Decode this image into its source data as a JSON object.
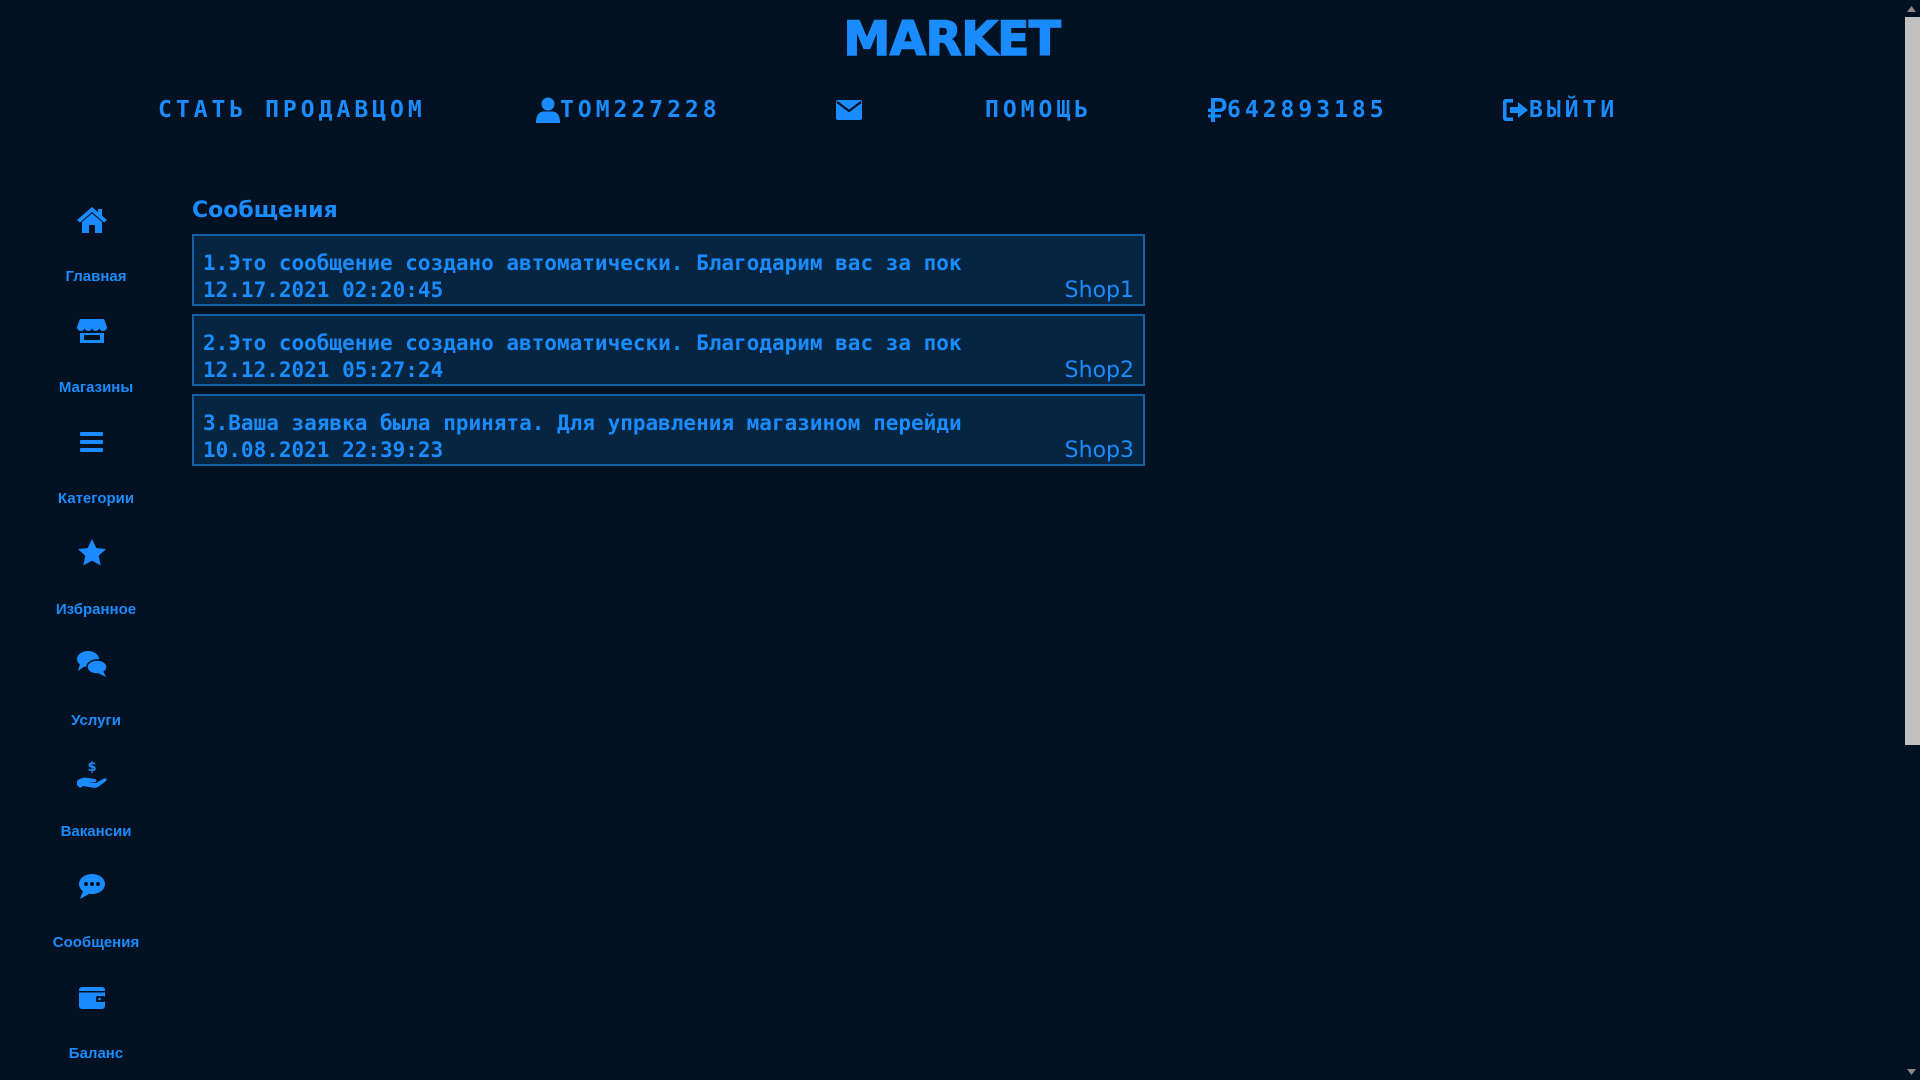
{
  "brand": "MARKET",
  "topnav": {
    "become_seller": "СТАТЬ ПРОДАВЦОМ",
    "username": "TOM227228",
    "help": "ПОМОЩЬ",
    "balance": "642893185",
    "logout": "ВЫЙТИ"
  },
  "sidebar": {
    "items": [
      {
        "label": "Главная",
        "icon": "home-icon"
      },
      {
        "label": "Магазины",
        "icon": "store-icon"
      },
      {
        "label": "Категории",
        "icon": "list-icon"
      },
      {
        "label": "Избранное",
        "icon": "star-icon"
      },
      {
        "label": "Услуги",
        "icon": "comments-icon"
      },
      {
        "label": "Вакансии",
        "icon": "hand-dollar-icon"
      },
      {
        "label": "Сообщения",
        "icon": "comment-icon"
      },
      {
        "label": "Баланс",
        "icon": "wallet-icon"
      }
    ]
  },
  "main": {
    "title": "Сообщения",
    "messages": [
      {
        "text": "1.Это сообщение создано автоматически. Благодарим вас за пок",
        "date": "12.17.2021 02:20:45",
        "shop": "Shop1"
      },
      {
        "text": "2.Это сообщение создано автоматически. Благодарим вас за пок",
        "date": "12.12.2021 05:27:24",
        "shop": "Shop2"
      },
      {
        "text": "3.Ваша заявка была принята. Для управления магазином перейди",
        "date": "10.08.2021 22:39:23",
        "shop": "Shop3"
      }
    ]
  },
  "colors": {
    "background": "#021222",
    "accent": "#1a8cff",
    "card_background": "#062540",
    "card_border": "#155fa4"
  }
}
